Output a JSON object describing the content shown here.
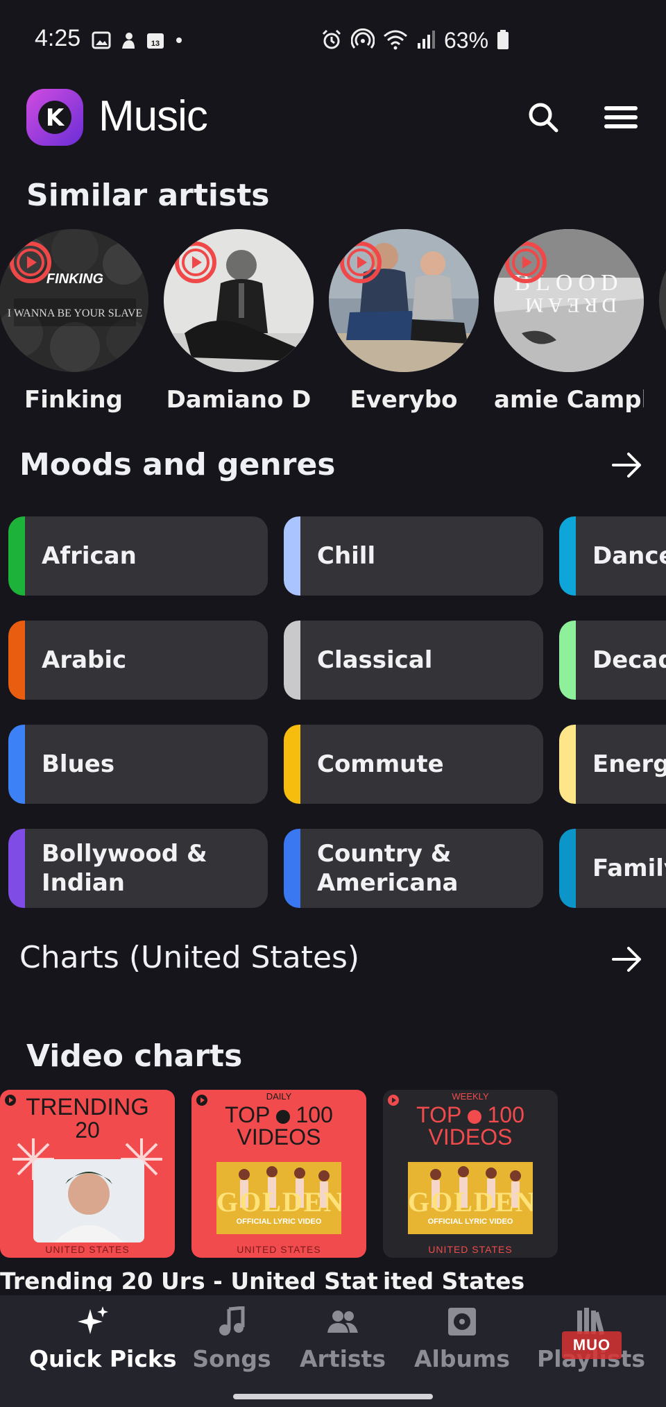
{
  "status_bar": {
    "time": "4:25",
    "battery_percent": "63%",
    "left_icons": [
      "image-icon",
      "app-icon",
      "calendar-icon",
      "dot-icon"
    ],
    "right_icons": [
      "alarm-icon",
      "hotspot-icon",
      "wifi-icon",
      "signal-icon",
      "battery-icon"
    ],
    "calendar_day": "13"
  },
  "header": {
    "title": "Music",
    "logo_letter": "K",
    "icons": [
      "search-icon",
      "menu-icon"
    ]
  },
  "similar_artists": {
    "title": "Similar artists",
    "items": [
      {
        "name": "Finking",
        "art_text_top": "FINKING",
        "art_text_bottom": "I WANNA BE YOUR SLAVE"
      },
      {
        "name": "Damiano D"
      },
      {
        "name": "Everybo"
      },
      {
        "name": "amie Campl",
        "art_text_top": "BLOOD",
        "art_text_bottom": "DREAM"
      }
    ]
  },
  "moods": {
    "title": "Moods and genres",
    "columns": [
      [
        {
          "label": "African",
          "color": "#1db33a"
        },
        {
          "label": "Arabic",
          "color": "#e85d10"
        },
        {
          "label": "Blues",
          "color": "#3c82f6"
        },
        {
          "label": "Bollywood &\nIndian",
          "color": "#7f4ce6"
        }
      ],
      [
        {
          "label": "Chill",
          "color": "#a9c4ff"
        },
        {
          "label": "Classical",
          "color": "#c9c9cc"
        },
        {
          "label": "Commute",
          "color": "#f7bd0e"
        },
        {
          "label": "Country &\nAmericana",
          "color": "#3a78f2"
        }
      ],
      [
        {
          "label": "Dance",
          "color": "#0ea5d8"
        },
        {
          "label": "Decade",
          "color": "#8ff09c"
        },
        {
          "label": "Energiz",
          "color": "#fde68a"
        },
        {
          "label": "Family",
          "color": "#0b95c8"
        }
      ]
    ]
  },
  "charts": {
    "title": "Charts (United States)"
  },
  "video_charts": {
    "title": "Video charts",
    "items": [
      {
        "caption": "Trending 20 Ur",
        "top": "TRENDING",
        "num": "20",
        "footer": "UNITED STATES",
        "bg": "#f14b4d"
      },
      {
        "caption": "s - United Stat",
        "small": "DAILY",
        "top": "TOP",
        "num": "100",
        "sub": "VIDEOS",
        "art": "GOLDEN",
        "art_sub": "OFFICIAL LYRIC VIDEO",
        "footer": "UNITED STATES",
        "bg": "#f14b4d"
      },
      {
        "caption": "ited States",
        "small": "WEEKLY",
        "top": "TOP",
        "num": "100",
        "sub": "VIDEOS",
        "art": "GOLDEN",
        "art_sub": "OFFICIAL LYRIC VIDEO",
        "footer": "UNITED STATES",
        "bg": "#26262b"
      }
    ]
  },
  "bottom_nav": {
    "items": [
      {
        "label": "Quick Picks",
        "icon": "sparkle-icon",
        "active": true
      },
      {
        "label": "Songs",
        "icon": "music-note-icon",
        "active": false
      },
      {
        "label": "Artists",
        "icon": "people-icon",
        "active": false
      },
      {
        "label": "Albums",
        "icon": "album-icon",
        "active": false
      },
      {
        "label": "Playlists",
        "icon": "library-icon",
        "active": false
      }
    ]
  },
  "watermark": "MUO",
  "colors": {
    "background": "#15151b",
    "chip": "#333338",
    "accent_red": "#f14b4d",
    "nav_bg": "#24242c",
    "nav_inactive": "#8c8c94"
  }
}
